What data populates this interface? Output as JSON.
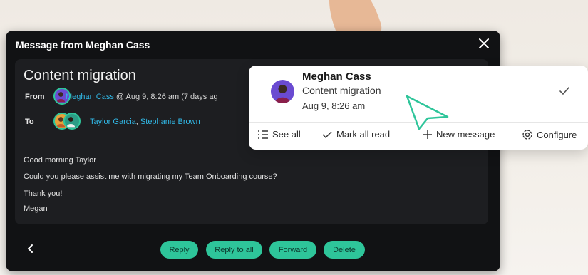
{
  "modal": {
    "title": "Message from Meghan Cass",
    "subject": "Content migration",
    "from_label": "From",
    "from_name": "Meghan Cass",
    "from_meta": " @ Aug 9, 8:26 am (7 days ag",
    "to_label": "To",
    "to_names": [
      "Taylor Garcia",
      "Stephanie Brown"
    ],
    "body": [
      "Good morning Taylor",
      "Could you please assist me with migrating my Team Onboarding course?",
      "Thank you!",
      "Megan"
    ],
    "buttons": {
      "reply": "Reply",
      "reply_all": "Reply to all",
      "forward": "Forward",
      "delete": "Delete"
    }
  },
  "notification": {
    "name": "Meghan Cass",
    "subject": "Content migration",
    "date": "Aug 9, 8:26 am",
    "actions": {
      "see_all": "See all",
      "mark_all_read": "Mark all read",
      "new_message": "New message",
      "configure": "Configure"
    }
  },
  "colors": {
    "accent": "#2ec59a",
    "link": "#31b8e6",
    "modal_bg": "#111214",
    "panel_bg": "#1d1e21"
  }
}
